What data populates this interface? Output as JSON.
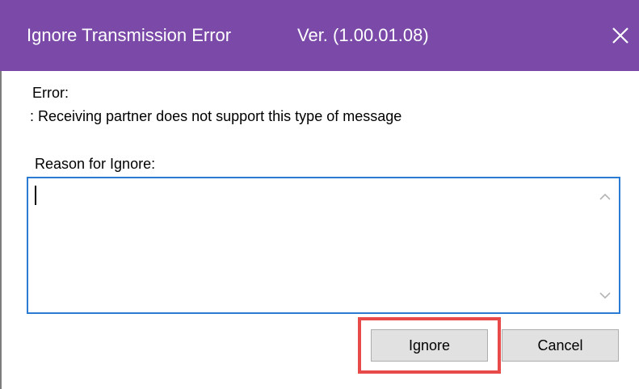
{
  "window": {
    "title": "Ignore Transmission Error",
    "version": "Ver. (1.00.01.08)",
    "close_icon": "close-icon"
  },
  "error": {
    "label": "Error:",
    "message": ": Receiving partner does not support this type of message"
  },
  "reason": {
    "label": "Reason for Ignore:",
    "value": "",
    "scroll_up_icon": "chevron-up-icon",
    "scroll_down_icon": "chevron-down-icon"
  },
  "buttons": {
    "ignore_label": "Ignore",
    "cancel_label": "Cancel"
  },
  "colors": {
    "titlebar": "#7b4aa8",
    "focus_border": "#2a7bd4",
    "highlight": "#e84a4a",
    "button_bg": "#e1e1e1"
  }
}
